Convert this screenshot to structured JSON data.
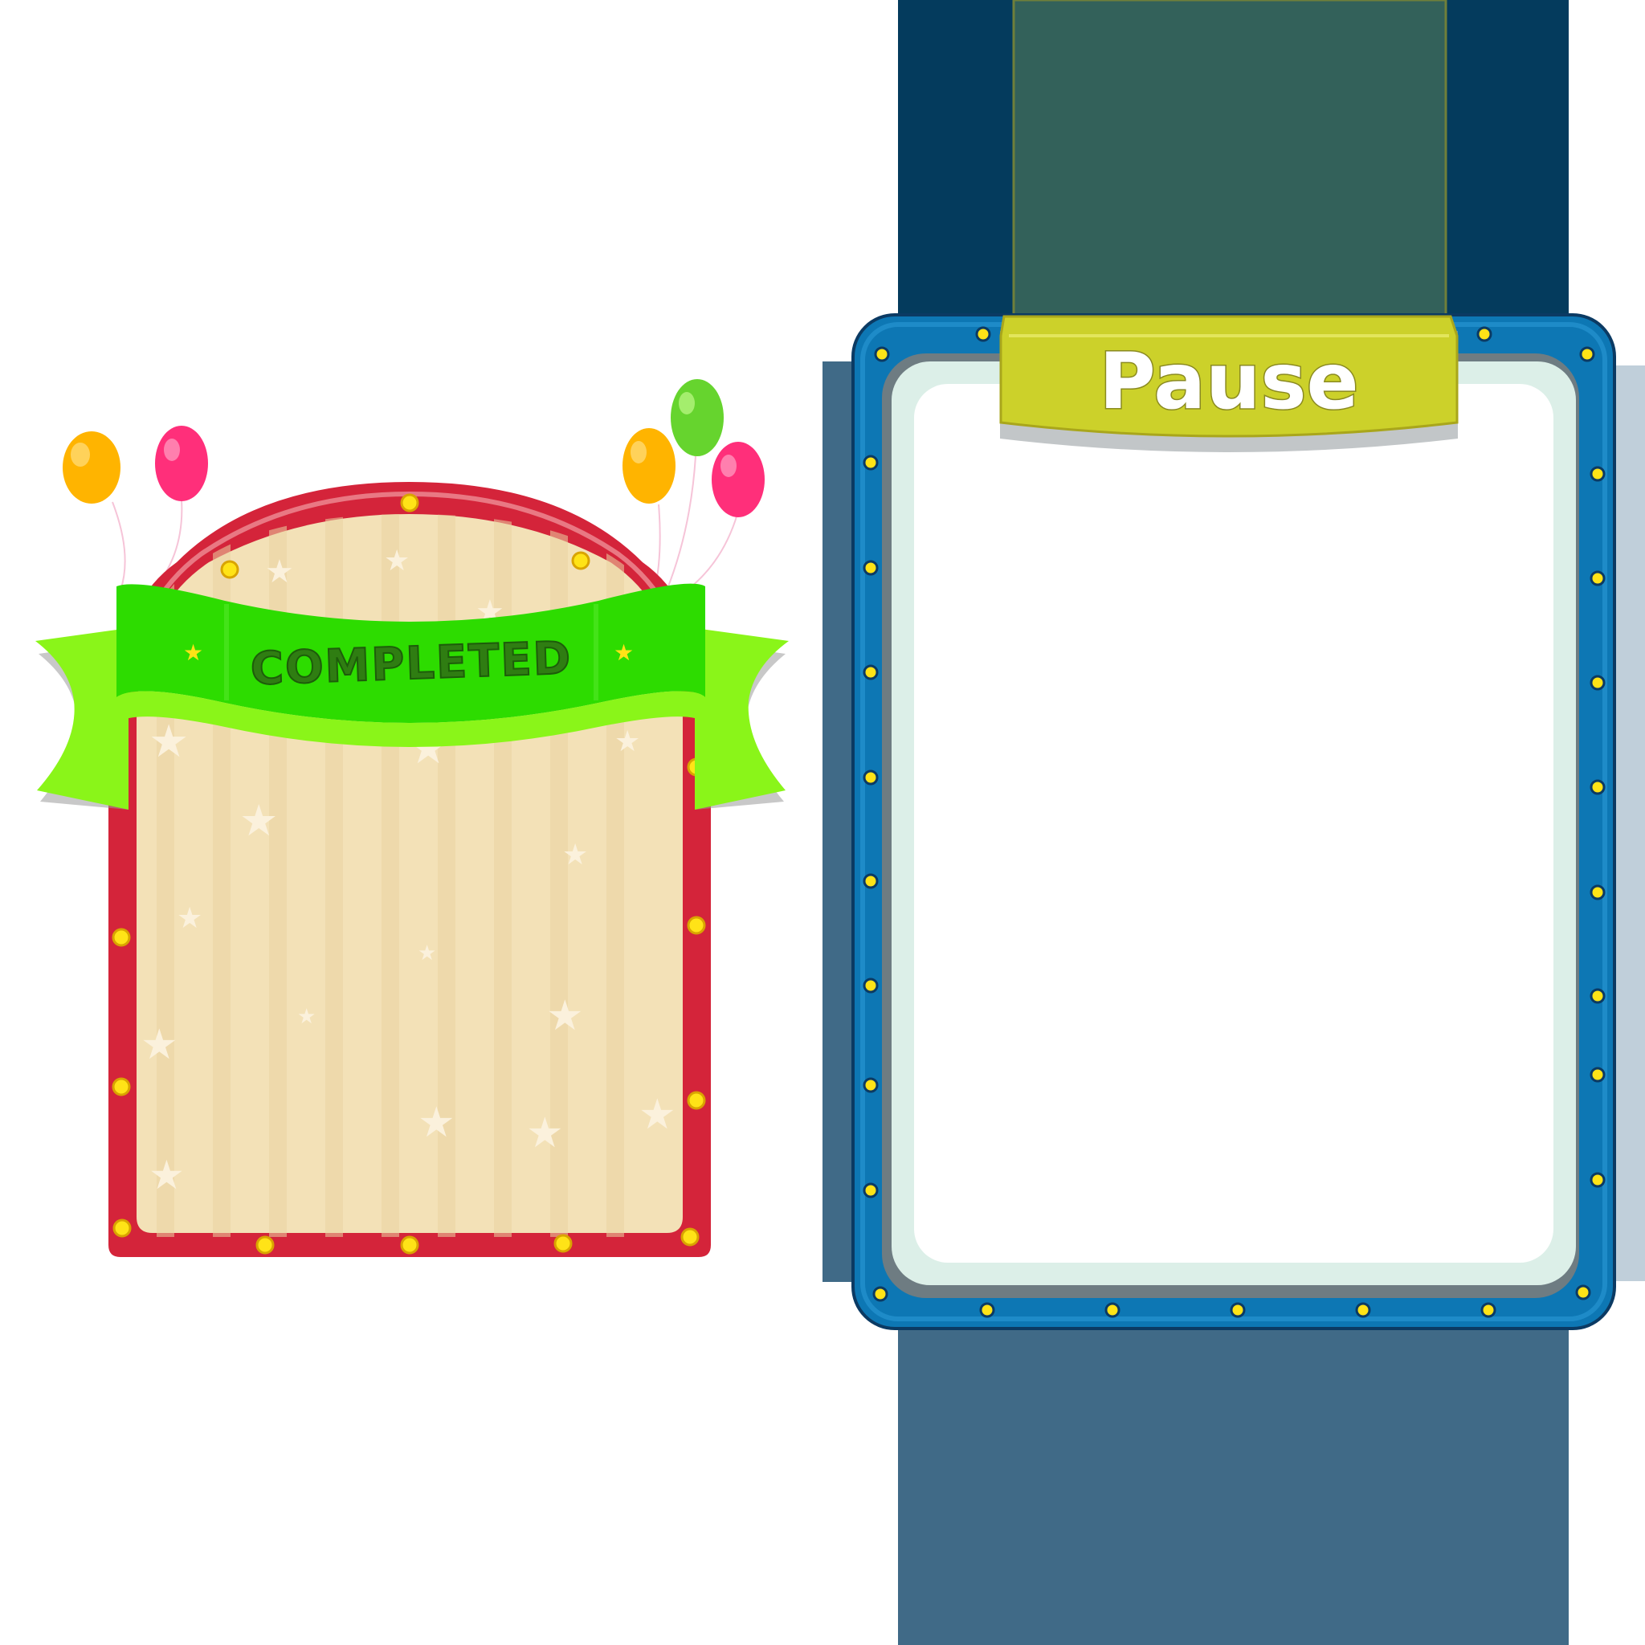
{
  "completed_panel": {
    "banner_label": "COMPLETED",
    "balloon_colors": [
      "#ffb400",
      "#ff2f7a",
      "#ffb400",
      "#66d42e",
      "#ff2f7a"
    ],
    "frame_color": "#d4243a",
    "panel_color": "#f3e1b7",
    "ribbon_color": "#2ddc00",
    "ribbon_tail_color": "#8af519",
    "bulb_color": "#ffe317"
  },
  "pause_panel": {
    "title": "Pause",
    "frame_color": "#0d77b4",
    "inner_color": "#dcefe8",
    "content_color": "#ffffff",
    "strap_color": "#33615a",
    "tab_color": "#ccd12a",
    "backdrop_colors": [
      "#043b5d",
      "#406a87"
    ],
    "bulb_color": "#ffe317"
  }
}
